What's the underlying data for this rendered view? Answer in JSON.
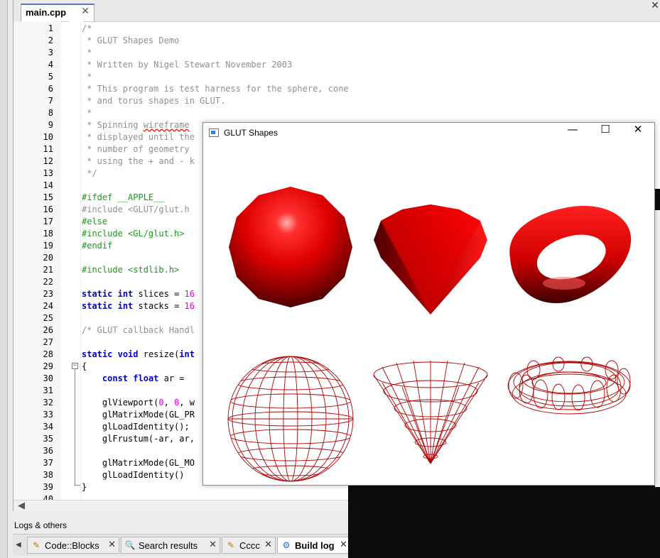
{
  "editor": {
    "tab_label": "main.cpp",
    "tab_close": "✕",
    "window_close": "✕",
    "line_numbers": [
      "1",
      "2",
      "3",
      "4",
      "5",
      "6",
      "7",
      "8",
      "9",
      "10",
      "11",
      "12",
      "13",
      "14",
      "15",
      "16",
      "17",
      "18",
      "19",
      "20",
      "21",
      "22",
      "23",
      "24",
      "25",
      "26",
      "27",
      "28",
      "29",
      "30",
      "31",
      "32",
      "33",
      "34",
      "35",
      "36",
      "37",
      "38",
      "39",
      "40"
    ],
    "scroll_left": "◀"
  },
  "logs": {
    "title": "Logs & others",
    "scroll_left": "◀",
    "tabs": [
      {
        "label": "Code::Blocks",
        "icon": "✎",
        "close": "✕"
      },
      {
        "label": "Search results",
        "icon": "🔍",
        "close": "✕"
      },
      {
        "label": "Cccc",
        "icon": "✎",
        "close": "✕"
      },
      {
        "label": "Build log",
        "icon": "⚙",
        "close": "✕"
      }
    ]
  },
  "glut_window": {
    "title": "GLUT Shapes",
    "minimize": "—",
    "maximize": "☐",
    "close": "✕"
  },
  "colors": {
    "comment": "#909090",
    "preprocessor": "#1a9a1a",
    "keyword": "#0000c8",
    "number": "#e000e0",
    "shape_red": "#ff0000",
    "tab_accent": "#4d7fc4"
  }
}
